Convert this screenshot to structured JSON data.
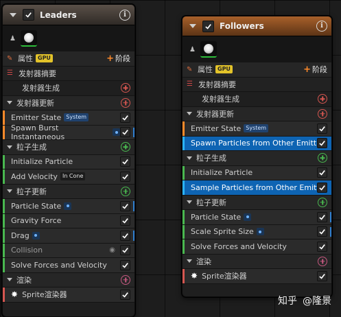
{
  "leaders": {
    "title": "Leaders",
    "properties_label": "属性",
    "gpu_badge": "GPU",
    "stage_label": "阶段",
    "emitter_summary": "发射器摘要",
    "emitter_spawn": "发射器生成",
    "emitter_update": "发射器更新",
    "emitter_state": "Emitter State",
    "system_badge": "System",
    "spawn_burst": "Spawn Burst Instantaneous",
    "particle_spawn": "粒子生成",
    "initialize_particle": "Initialize Particle",
    "add_velocity": "Add Velocity",
    "in_cone_badge": "In Cone",
    "particle_update": "粒子更新",
    "particle_state": "Particle State",
    "gravity_force": "Gravity Force",
    "drag": "Drag",
    "collision": "Collision",
    "solve_forces": "Solve Forces and Velocity",
    "render": "渲染",
    "sprite_renderer": "Sprite渲染器"
  },
  "followers": {
    "title": "Followers",
    "properties_label": "属性",
    "gpu_badge": "GPU",
    "stage_label": "阶段",
    "emitter_summary": "发射器摘要",
    "emitter_spawn": "发射器生成",
    "emitter_update": "发射器更新",
    "emitter_state": "Emitter State",
    "system_badge": "System",
    "spawn_from_other": "Spawn Particles from Other Emitter",
    "particle_spawn": "粒子生成",
    "initialize_particle": "Initialize Particle",
    "sample_from_other": "Sample Particles from Other Emitter",
    "particle_update": "粒子更新",
    "particle_state": "Particle State",
    "scale_sprite_size": "Scale Sprite Size",
    "solve_forces": "Solve Forces and Velocity",
    "render": "渲染",
    "sprite_renderer": "Sprite渲染器"
  },
  "watermark": {
    "site": "知乎",
    "author": "@隆景"
  },
  "colors": {
    "accent_blue": "#0e64b3",
    "spawn_orange": "#ff8a2a",
    "particle_green": "#49b84f",
    "render_red": "#d65650"
  }
}
